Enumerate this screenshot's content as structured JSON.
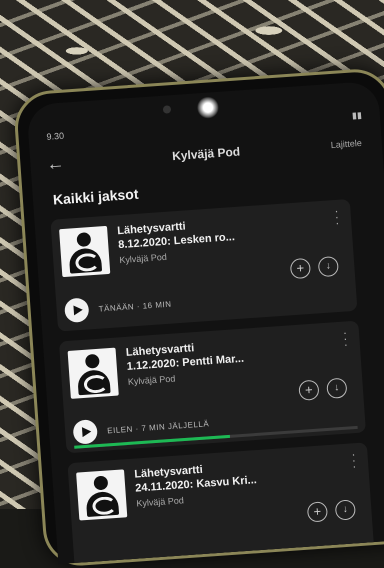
{
  "status": {
    "time": "9.30"
  },
  "topbar": {
    "title": "Kylväjä Pod",
    "sort_label": "Lajittele"
  },
  "section_title": "Kaikki jaksot",
  "episodes": [
    {
      "series": "Lähetysvartti",
      "title": "8.12.2020: Lesken ro...",
      "podcast": "Kylväjä Pod",
      "meta": "TÄNÄÄN · 16 MIN",
      "progress": 0
    },
    {
      "series": "Lähetysvartti",
      "title": "1.12.2020: Pentti Mar...",
      "podcast": "Kylväjä Pod",
      "meta": "EILEN · 7 MIN JÄLJELLÄ",
      "progress": 0.55
    },
    {
      "series": "Lähetysvartti",
      "title": "24.11.2020: Kasvu Kri...",
      "podcast": "Kylväjä Pod",
      "meta": "",
      "progress": 0
    }
  ],
  "colors": {
    "accent": "#1db954",
    "frame": "#8b8657"
  },
  "icons": [
    "back-arrow-icon",
    "more-icon",
    "add-icon",
    "download-icon",
    "play-icon"
  ]
}
